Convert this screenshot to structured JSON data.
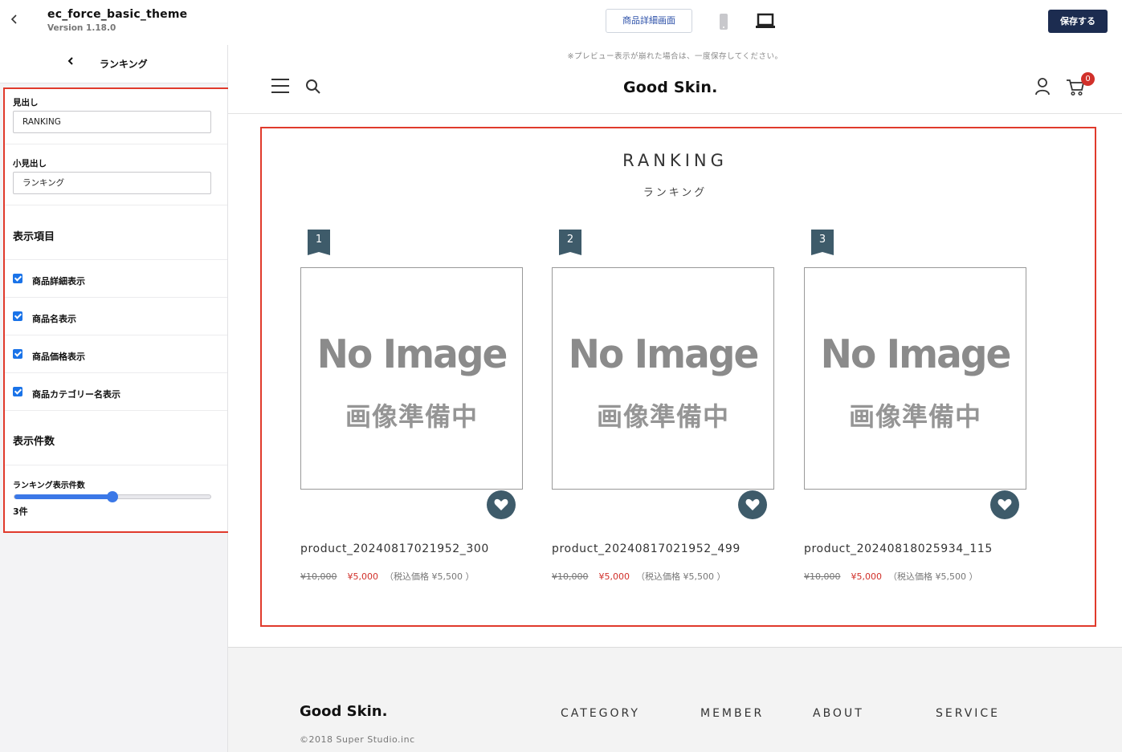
{
  "app": {
    "theme_name": "ec_force_basic_theme",
    "version": "Version 1.18.0",
    "page_select": "商品詳細画面",
    "save_label": "保存する",
    "back_icon": "chevron-left-icon"
  },
  "sidebar": {
    "title": "ランキング",
    "heading_label": "見出し",
    "heading_value": "RANKING",
    "subheading_label": "小見出し",
    "subheading_value": "ランキング",
    "display_items_title": "表示項目",
    "checkboxes": [
      {
        "label": "商品詳細表示",
        "checked": true
      },
      {
        "label": "商品名表示",
        "checked": true
      },
      {
        "label": "商品価格表示",
        "checked": true
      },
      {
        "label": "商品カテゴリー名表示",
        "checked": true
      }
    ],
    "count_title": "表示件数",
    "slider_label": "ランキング表示件数",
    "slider_value_text": "3件",
    "slider_fraction": 0.5,
    "highlight_color": "#e03a2c",
    "accent_color": "#3b78e7"
  },
  "preview": {
    "notice": "※プレビュー表示が崩れた場合は、一度保存してください。",
    "logo": "Good Skin.",
    "cart_count": "0",
    "section_title": "RANKING",
    "section_subtitle": "ランキング",
    "no_image_en": "No Image",
    "no_image_ja": "画像準備中",
    "products": [
      {
        "rank": "1",
        "name": "product_20240817021952_300",
        "old_price": "¥10,000",
        "price": "¥5,000",
        "tax": "（税込価格 ¥5,500 ）"
      },
      {
        "rank": "2",
        "name": "product_20240817021952_499",
        "old_price": "¥10,000",
        "price": "¥5,000",
        "tax": "（税込価格 ¥5,500 ）"
      },
      {
        "rank": "3",
        "name": "product_20240818025934_115",
        "old_price": "¥10,000",
        "price": "¥5,000",
        "tax": "（税込価格 ¥5,500 ）"
      }
    ],
    "footer": {
      "logo": "Good Skin.",
      "copyright": "©2018 Super Studio.inc",
      "menus": [
        "CATEGORY",
        "MEMBER",
        "ABOUT",
        "SERVICE"
      ]
    }
  }
}
